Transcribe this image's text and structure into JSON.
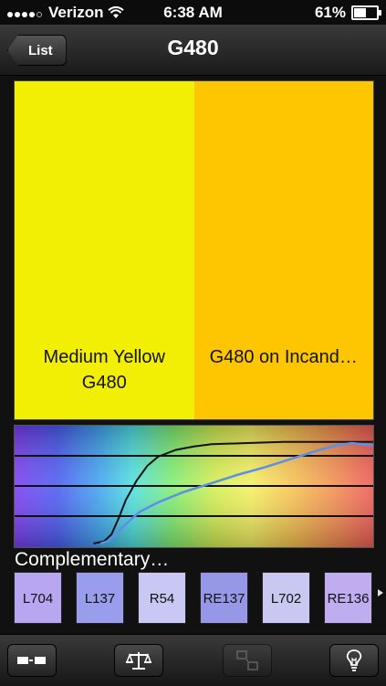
{
  "status": {
    "carrier": "Verizon",
    "time": "6:38 AM",
    "battery": "61%",
    "battery_level": 0.61,
    "signal_bars": 4,
    "signal_max": 5
  },
  "nav": {
    "back_label": "List",
    "title": "G480"
  },
  "swatches": [
    {
      "label_line1": "Medium Yellow",
      "label_line2": "G480",
      "color": "#f2ef04"
    },
    {
      "label_line1": "G480 on Incand…",
      "label_line2": "",
      "color": "#fec501"
    }
  ],
  "spectrum": {
    "curve_black": [
      [
        0.22,
        0.0
      ],
      [
        0.25,
        0.02
      ],
      [
        0.27,
        0.08
      ],
      [
        0.29,
        0.22
      ],
      [
        0.31,
        0.38
      ],
      [
        0.34,
        0.55
      ],
      [
        0.37,
        0.68
      ],
      [
        0.4,
        0.76
      ],
      [
        0.45,
        0.82
      ],
      [
        0.5,
        0.85
      ],
      [
        0.55,
        0.87
      ],
      [
        0.65,
        0.88
      ],
      [
        0.75,
        0.89
      ],
      [
        0.85,
        0.89
      ],
      [
        1.0,
        0.89
      ]
    ],
    "curve_blue": [
      [
        0.24,
        0.0
      ],
      [
        0.26,
        0.02
      ],
      [
        0.28,
        0.08
      ],
      [
        0.31,
        0.17
      ],
      [
        0.35,
        0.28
      ],
      [
        0.4,
        0.36
      ],
      [
        0.47,
        0.45
      ],
      [
        0.55,
        0.53
      ],
      [
        0.62,
        0.6
      ],
      [
        0.7,
        0.67
      ],
      [
        0.78,
        0.75
      ],
      [
        0.85,
        0.82
      ],
      [
        0.9,
        0.86
      ],
      [
        0.94,
        0.88
      ],
      [
        0.97,
        0.87
      ],
      [
        1.0,
        0.86
      ]
    ]
  },
  "complementary": {
    "title": "Complementary…",
    "items": [
      {
        "name": "L704",
        "color": "#b8a6f0"
      },
      {
        "name": "L137",
        "color": "#9a9cec"
      },
      {
        "name": "R54",
        "color": "#c9c8f4"
      },
      {
        "name": "RE137",
        "color": "#9797e8"
      },
      {
        "name": "L702",
        "color": "#c8c8f1"
      },
      {
        "name": "RE136",
        "color": "#c0adf0"
      }
    ]
  },
  "toolbar": {
    "items": [
      {
        "icon": "swatch-compare-icon",
        "enabled": true
      },
      {
        "icon": "balance-scale-icon",
        "enabled": true
      },
      {
        "icon": "crop-icon",
        "enabled": false
      },
      {
        "icon": "lightbulb-icon",
        "enabled": true
      }
    ]
  }
}
